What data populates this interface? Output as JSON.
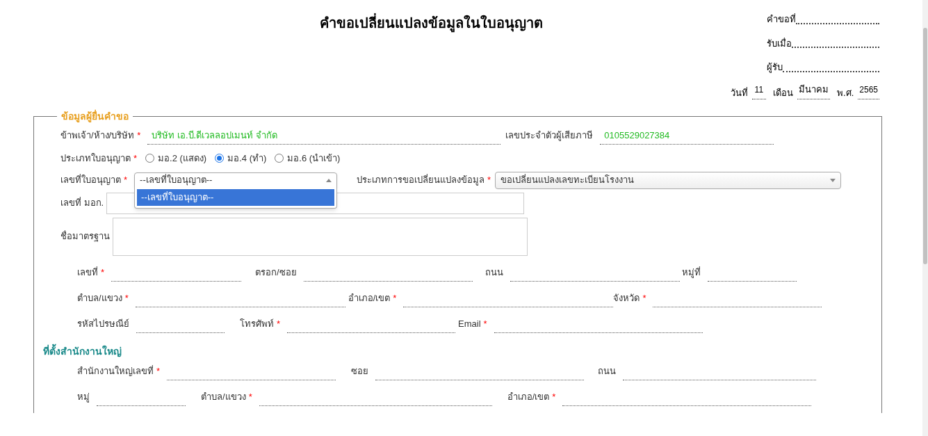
{
  "title": "คำขอเปลี่ยนแปลงข้อมูลในใบอนุญาต",
  "receipt": [
    {
      "label": "คำขอที่"
    },
    {
      "label": "รับเมื่อ"
    },
    {
      "label": "ผู้รับ"
    }
  ],
  "date": {
    "day_label": "วันที่",
    "day": "11",
    "month_label": "เดือน",
    "month": "มีนาคม",
    "year_label": "พ.ศ.",
    "year": "2565"
  },
  "section": {
    "legend": "ข้อมูลผู้ยื่นคำขอ"
  },
  "applicant": {
    "label": "ข้าพเจ้า/ห้าง/บริษัท",
    "required_mark": "*",
    "value": "บริษัท เอ.บี.ดีเวลลอปเมนท์ จำกัด"
  },
  "tax_id": {
    "label": "เลขประจำตัวผู้เสียภาษี",
    "value": "0105529027384"
  },
  "license_type": {
    "label": "ประเภทใบอนุญาต",
    "required_mark": "*",
    "options": [
      {
        "label": "มอ.2 (แสดง)",
        "selected": false
      },
      {
        "label": "มอ.4 (ทำ)",
        "selected": true
      },
      {
        "label": "มอ.6 (นำเข้า)",
        "selected": false
      }
    ]
  },
  "license_no": {
    "label": "เลขที่ใบอนุญาต",
    "required_mark": "*",
    "value": "--เลขที่ใบอนุญาต--",
    "expanded": true,
    "options": [
      {
        "label": "--เลขที่ใบอนุญาต--",
        "selected": true
      }
    ]
  },
  "change_type": {
    "label": "ประเภทการขอเปลี่ยนแปลงข้อมูล",
    "required_mark": "*",
    "value": "ขอเปลี่ยนแปลงเลขทะเบียนโรงงาน"
  },
  "tis_no": {
    "label": "เลขที่ มอก."
  },
  "standard_name": {
    "label": "ชื่อมาตรฐาน"
  },
  "address_rows": [
    [
      {
        "label": "เลขที่",
        "required_mark": "*"
      },
      {
        "label": "ตรอก/ซอย"
      },
      {
        "label": "ถนน"
      },
      {
        "label": "หมู่ที่"
      }
    ],
    [
      {
        "label": "ตำบล/แขวง",
        "required_mark": "*"
      },
      {
        "label": "อำเภอ/เขต",
        "required_mark": "*"
      },
      {
        "label": "จังหวัด",
        "required_mark": "*"
      }
    ],
    [
      {
        "label": "รหัสไปรษณีย์"
      },
      {
        "label": "โทรศัพท์",
        "required_mark": "*"
      },
      {
        "label": "Email",
        "required_mark": "*"
      }
    ]
  ],
  "head_office": {
    "heading": "ที่ตั้งสำนักงานใหญ่",
    "rows": [
      [
        {
          "label": "สำนักงานใหญ่เลขที่",
          "required_mark": "*"
        },
        {
          "label": "ซอย"
        },
        {
          "label": "ถนน"
        }
      ],
      [
        {
          "label": "หมู่"
        },
        {
          "label": "ตำบล/แขวง",
          "required_mark": "*"
        },
        {
          "label": "อำเภอ/เขต",
          "required_mark": "*"
        }
      ]
    ]
  }
}
